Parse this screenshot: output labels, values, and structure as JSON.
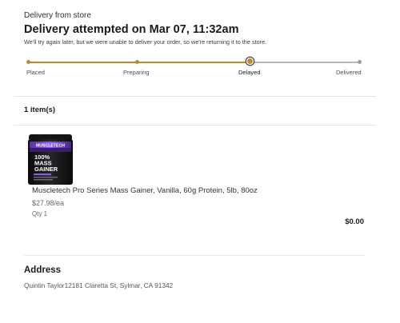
{
  "header": {
    "label": "Delivery from store",
    "title": "Delivery attempted on Mar 07, 11:32am",
    "subtitle": "We'll try again later, but we were unable to deliver your order, so we're returning it to the store."
  },
  "tracker": {
    "steps": [
      {
        "label": "Placed",
        "state": "done"
      },
      {
        "label": "Preparing",
        "state": "done"
      },
      {
        "label": "Delayed",
        "state": "current"
      },
      {
        "label": "Delivered",
        "state": "pending"
      }
    ],
    "colors": {
      "done": "#c48a2a",
      "pending": "#b8b8b8"
    }
  },
  "items": {
    "count_label": "1 item(s)",
    "list": [
      {
        "name": "Muscletech Pro Series Mass Gainer, Vanilla, 60g Protein, 5lb, 80oz",
        "price": "$27.98/ea",
        "qty": "Qty 1",
        "total": "$0.00",
        "image": {
          "brand": "MUSCLETECH",
          "line1": "100%",
          "line2": "MASS",
          "line3": "GAINER"
        }
      }
    ]
  },
  "address": {
    "heading": "Address",
    "text": "Quintin Taylor12181 Claretta St, Sylmar, CA 91342"
  }
}
